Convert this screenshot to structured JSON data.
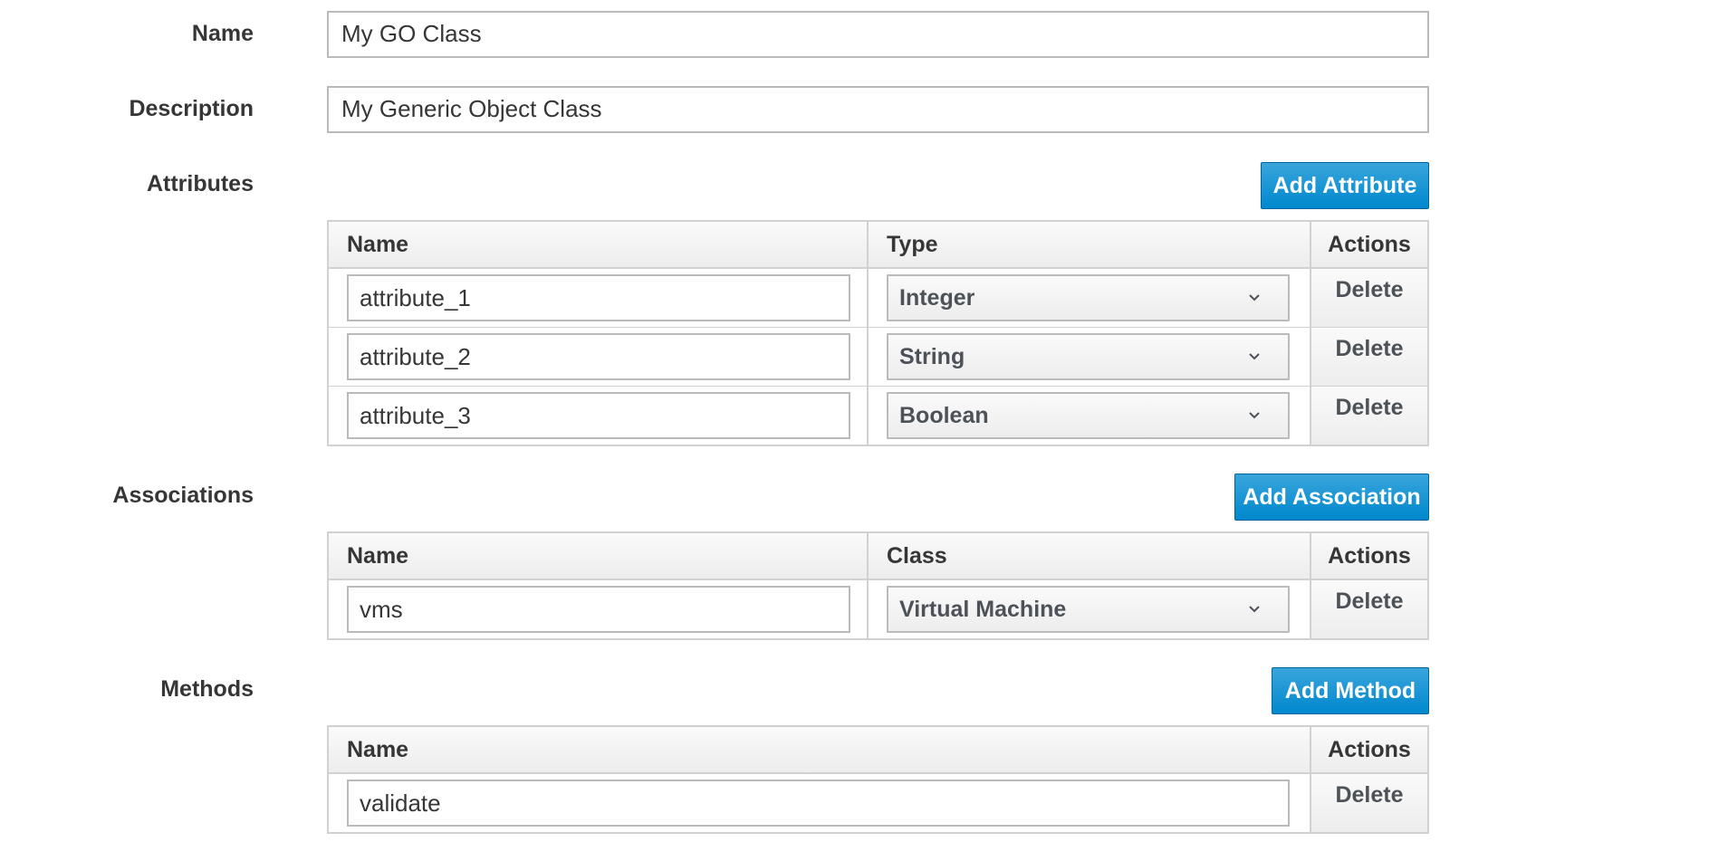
{
  "form": {
    "name_label": "Name",
    "name_value": "My GO Class",
    "description_label": "Description",
    "description_value": "My Generic Object Class"
  },
  "attributes": {
    "label": "Attributes",
    "add_button": "Add Attribute",
    "columns": [
      "Name",
      "Type",
      "Actions"
    ],
    "rows": [
      {
        "name": "attribute_1",
        "type": "Integer",
        "action": "Delete"
      },
      {
        "name": "attribute_2",
        "type": "String",
        "action": "Delete"
      },
      {
        "name": "attribute_3",
        "type": "Boolean",
        "action": "Delete"
      }
    ]
  },
  "associations": {
    "label": "Associations",
    "add_button": "Add Association",
    "columns": [
      "Name",
      "Class",
      "Actions"
    ],
    "rows": [
      {
        "name": "vms",
        "class": "Virtual Machine",
        "action": "Delete"
      }
    ]
  },
  "methods": {
    "label": "Methods",
    "add_button": "Add Method",
    "columns": [
      "Name",
      "Actions"
    ],
    "rows": [
      {
        "name": "validate",
        "action": "Delete"
      }
    ]
  },
  "icons": {
    "select_caret": "chevron-down-icon"
  },
  "colors": {
    "primary_button": "#0088ce",
    "table_border": "#d1d1d1",
    "input_border": "#bababa",
    "text": "#363636"
  }
}
